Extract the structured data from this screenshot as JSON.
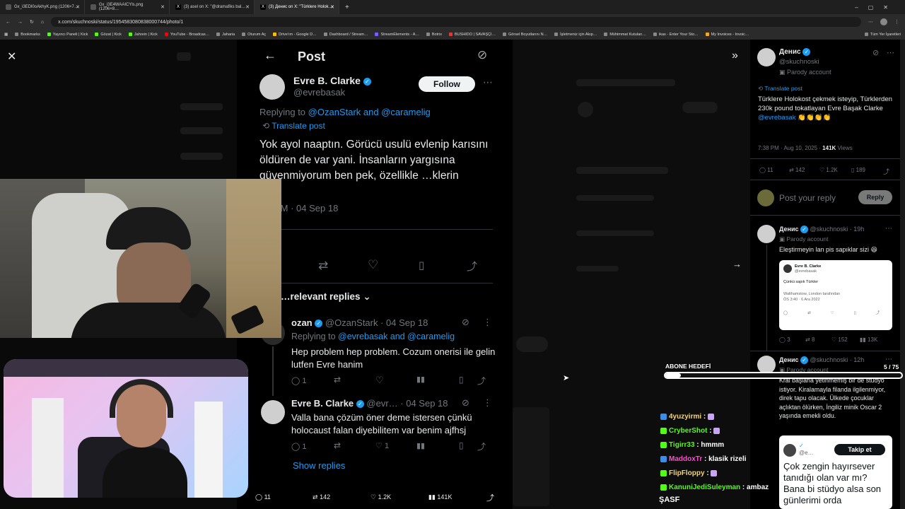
{
  "browser": {
    "tabs": [
      {
        "label": "Gx_i3EDl0oAkhyK.png (1206×7…",
        "active": false
      },
      {
        "label": "Gx_i3E4WAAICYls.png (1206×8…",
        "active": false
      },
      {
        "label": "(3) asel on X: \"@dramafiks bal…",
        "active": false
      },
      {
        "label": "(3) Денис on X: \"Türklere Holok…",
        "active": true
      }
    ],
    "url": "x.com/skuchnoski/status/1954583080838000744/photo/1",
    "bookmarks": [
      "Bookmarks",
      "Yayıncı Paneli | Kick",
      "Gözat | Kick",
      "Jahrein | Kick",
      "YouTube - Broadcas…",
      "Jaharia",
      "Oturum Aç",
      "Drive'ım - Google D…",
      "Dashboard / Stream…",
      "StreamElements - A…",
      "Botrix",
      "BUSHIDO | SAVAŞÇI…",
      "Görsel Boyutlarını N…",
      "İşletmeniz için Akıp…",
      "Mühimmat Kutuları…",
      "ikas - Enter Your Sto…",
      "My Invoices - Invoic…"
    ],
    "bookmarks_all": "Tüm Yer İşaretleri"
  },
  "post": {
    "header_title": "Post",
    "author_name": "Evre B. Clarke",
    "author_handle": "@evrebasak",
    "follow_label": "Follow",
    "replying_to": "Replying to ",
    "replying_users": "@OzanStark and @caramelig",
    "translate": "Translate post",
    "body": "Yok ayol naaptın. Görücü usulü evlenip karısını öldüren de var yani. İnsanların yargısına güvenmiyorum ben pek, özellikle …klerin",
    "timestamp": "…PM · 04 Sep 18",
    "relevant_replies": "…relevant replies",
    "replies": [
      {
        "name": "ozan",
        "handle": "@OzanStark · 04 Sep 18",
        "replying_to": "Replying to ",
        "replying_users": "@evrebasak and @caramelig",
        "text": "Hep problem hep problem. Cozum onerisi ile gelin lutfen Evre hanim",
        "reply_count": "1",
        "like_count": ""
      },
      {
        "name": "Evre B. Clarke",
        "handle": "@evr… · 04 Sep 18",
        "text": "Valla bana çözüm öner deme istersen çünkü holocaust falan diyebilitem var benim ajfhsj",
        "reply_count": "1",
        "like_count": "1"
      }
    ],
    "show_replies": "Show replies",
    "bottom_bar": {
      "replies": "11",
      "reposts": "142",
      "likes": "1.2K",
      "views": "141K"
    }
  },
  "sidebar": {
    "name": "Денис",
    "handle": "@skuchnoski",
    "parody": "Parody account",
    "translate": "Translate post",
    "tweet_text_pre": "Türklere Holokost çekmek isteyip, Türklerden 230k pound tokatlayan Evre Başak Clarke ",
    "tweet_mention": "@evrebasak",
    "tweet_emoji": "👏👏👏👏",
    "meta_time": "7:38 PM · Aug 10, 2025 · ",
    "meta_views": "141K",
    "meta_views_label": " Views",
    "stats": {
      "replies": "11",
      "reposts": "142",
      "likes": "1.2K",
      "bookmarks": "189"
    },
    "reply_placeholder": "Post your reply",
    "reply_button": "Reply",
    "reply1": {
      "name": "Денис",
      "handle": "@skuchnoski · 19h",
      "parody": "Parody account",
      "text": "Eleştirmeyin lan pis sapıklar sizi 😆",
      "card_name": "Evre B. Clarke",
      "card_handle": "@evrebasak",
      "card_text": "Çünkü sapık Türkler",
      "card_loc": "Waltham­stow, London tarafından",
      "card_time": "ÖS 3:40 · 6 Ara 2022",
      "stats": {
        "replies": "3",
        "reposts": "8",
        "likes": "152",
        "views": "13K"
      }
    },
    "reply2": {
      "name": "Денис",
      "handle": "@skuchnoski · 12h",
      "parody": "Parody account",
      "text": "Kral başlarla yetinmemiş bir de stüdyo istiyor. Kiralamayla filanda ilgilenmiyor, direk tapu olacak. Ülkede çocuklar açlıktan ölürken, İngiliz minik Oscar 2 yaşında emekli oldu.",
      "card_handle": "@e…",
      "card_follow": "Takip et",
      "card_text": "Çok zengin hayırsever tanıdığı olan var mı? Bana bi stüdyo alsa son günlerimi orda"
    }
  },
  "overlay": {
    "goal_label": "ABONE HEDEFİ",
    "goal_count": "5 / 75",
    "goal_fraction": 0.067,
    "chat": [
      {
        "user": "4yuzyirmi",
        "msg": "",
        "color": "#f5d46a",
        "icon": "#3a8ee6"
      },
      {
        "user": "CryberShot",
        "msg": "",
        "color": "#53fc18",
        "icon": "#53fc18"
      },
      {
        "user": "Tigirr33",
        "msg": "hmmm",
        "color": "#53fc18",
        "icon": "#53fc18"
      },
      {
        "user": "MaddoxTr",
        "msg": "klasik rizeli",
        "color": "#ff4dcc",
        "icon": "#3a8ee6"
      },
      {
        "user": "FlipFloppy",
        "msg": "",
        "color": "#f5d46a",
        "icon": "#53fc18"
      },
      {
        "user": "KanuniJediSuleyman",
        "msg": "ambaz",
        "color": "#53fc18",
        "icon": "#53fc18"
      }
    ],
    "bottom_text": "ŞASF"
  }
}
